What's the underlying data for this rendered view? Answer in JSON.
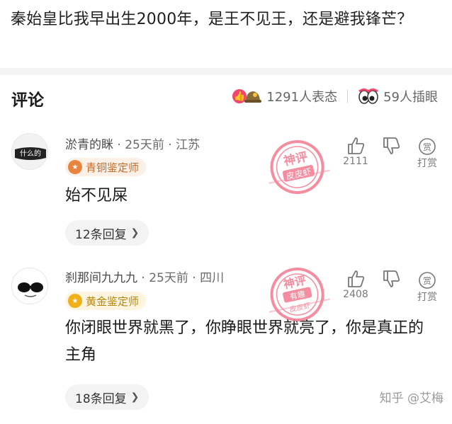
{
  "post": {
    "title": "秦始皇比我早出生2000年，是王不见王，还是避我锋芒？"
  },
  "comments_header": {
    "title": "评论",
    "reactions_count": "1291人表态",
    "insert_eyes_count": "59人插眼"
  },
  "comments": [
    {
      "name": "淤青的眯",
      "time": "25天前",
      "location": "江苏",
      "badge": "青铜鉴定师",
      "text": "始不见屎",
      "likes": "2111",
      "tip_label": "打赏",
      "tip_glyph": "赏",
      "replies": "12条回复",
      "avatar_text": "什么的",
      "stamp": {
        "line1": "神评",
        "line2": "皮皮虾",
        "color": "#f27a8f"
      }
    },
    {
      "name": "刹那间九九九",
      "time": "25天前",
      "location": "四川",
      "badge": "黄金鉴定师",
      "text": "你闭眼世界就黑了，你睁眼世界就亮了，你是真正的主角",
      "likes": "2408",
      "tip_label": "打赏",
      "tip_glyph": "赏",
      "replies": "18条回复",
      "stamp": {
        "line1": "神评",
        "line2": "有趣",
        "line3": "皮皮虾",
        "color": "#f27a8f"
      }
    }
  ],
  "watermark": "知乎 @艾梅",
  "colors": {
    "accent_pink": "#f0476f",
    "bronze": "#c46a28",
    "gold": "#b7860b"
  },
  "icons": [
    "like-reaction-icon",
    "helmet-reaction-icon",
    "eyes-icon",
    "thumb-up-icon",
    "thumb-down-icon",
    "tip-icon",
    "badge-icon",
    "chevron-right-icon"
  ]
}
